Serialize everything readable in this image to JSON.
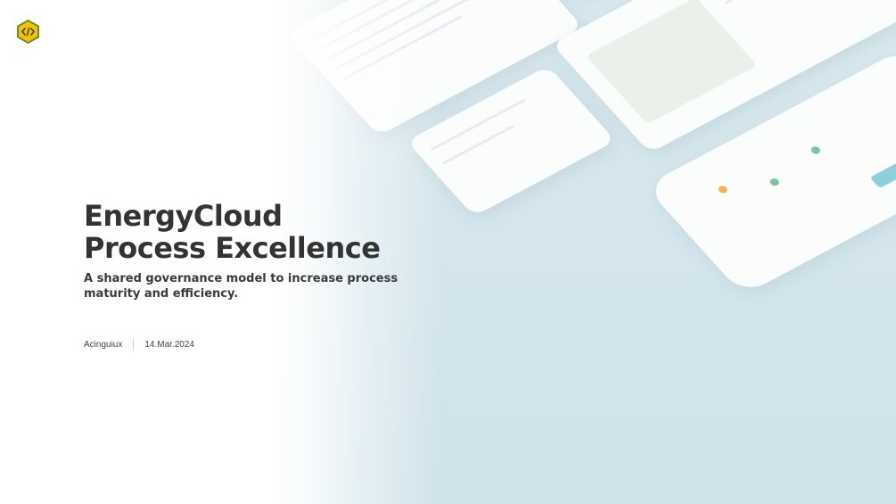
{
  "slide": {
    "logo_icon": "code-brackets-icon",
    "title_line1": "EnergyCloud",
    "title_line2": "Process Excellence",
    "subtitle": "A shared governance model to increase process maturity and efficiency.",
    "author": "Acinguiux",
    "date": "14.Mar.2024"
  },
  "colors": {
    "logo_fill": "#f2c200",
    "logo_border": "#6b8f2a",
    "title": "#333333",
    "background_panel": "#d5e6ec",
    "accent_teal": "#8fcfd9"
  }
}
